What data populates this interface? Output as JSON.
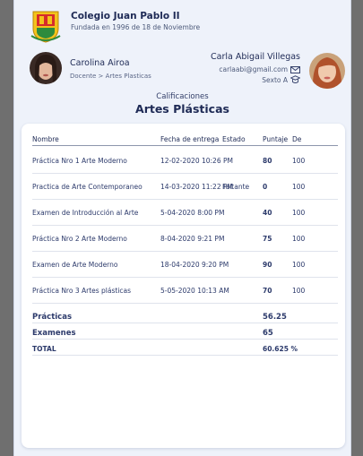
{
  "school": {
    "name": "Colegio Juan Pablo II",
    "founded": "Fundada en 1996 de 18 de Noviembre"
  },
  "teacher": {
    "name": "Carolina Airoa",
    "role": "Docente > Artes Plasticas"
  },
  "student": {
    "name": "Carla Abigail Villegas",
    "email": "carlaabi@gmail.com",
    "grade": "Sexto A"
  },
  "section": {
    "subtitle": "Calificaciones",
    "title": "Artes Plásticas"
  },
  "table": {
    "headers": {
      "name": "Nombre",
      "date": "Fecha de entrega",
      "state": "Estado",
      "score": "Puntaje",
      "of": "De"
    },
    "rows": [
      {
        "name": "Práctica Nro 1 Arte Moderno",
        "date": "12-02-2020 10:26 PM",
        "state": "",
        "score": "80",
        "of": "100"
      },
      {
        "name": "Practica de Arte Contemporaneo",
        "date": "14-03-2020 11:22 PM",
        "state": "Faltante",
        "score": "0",
        "of": "100"
      },
      {
        "name": "Examen de Introducción al Arte",
        "date": "5-04-2020 8:00 PM",
        "state": "",
        "score": "40",
        "of": "100"
      },
      {
        "name": "Práctica Nro 2 Arte Moderno",
        "date": "8-04-2020 9:21 PM",
        "state": "",
        "score": "75",
        "of": "100"
      },
      {
        "name": "Examen de Arte Moderno",
        "date": "18-04-2020 9:20 PM",
        "state": "",
        "score": "90",
        "of": "100"
      },
      {
        "name": "Práctica Nro 3 Artes plásticas",
        "date": "5-05-2020 10:13 AM",
        "state": "",
        "score": "70",
        "of": "100"
      }
    ],
    "summary": [
      {
        "label": "Prácticas",
        "value": "56.25"
      },
      {
        "label": "Examenes",
        "value": "65"
      },
      {
        "label": "TOTAL",
        "value": "60.625 %"
      }
    ]
  },
  "icons": {
    "crest": "school-crest-icon",
    "mail": "mail-icon",
    "grade": "graduation-cap-icon"
  },
  "colors": {
    "text": "#1e2a55",
    "background": "#eef2fa",
    "card": "#ffffff"
  }
}
